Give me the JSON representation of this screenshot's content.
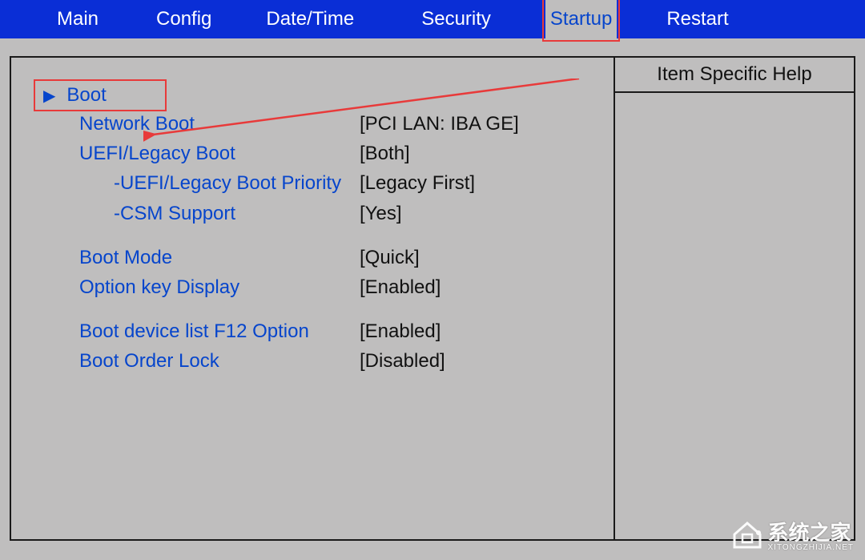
{
  "tabs": {
    "main": "Main",
    "config": "Config",
    "datetime": "Date/Time",
    "security": "Security",
    "startup": "Startup",
    "restart": "Restart"
  },
  "help": {
    "title": "Item Specific Help"
  },
  "items": {
    "boot": "Boot",
    "network_boot": {
      "label": "Network Boot",
      "value": "[PCI LAN: IBA GE]"
    },
    "uefi_legacy": {
      "label": "UEFI/Legacy Boot",
      "value": "[Both]"
    },
    "uefi_priority": {
      "label": "-UEFI/Legacy Boot Priority",
      "value": "[Legacy First]"
    },
    "csm": {
      "label": "-CSM Support",
      "value": "[Yes]"
    },
    "boot_mode": {
      "label": "Boot Mode",
      "value": "[Quick]"
    },
    "option_key": {
      "label": "Option key Display",
      "value": "[Enabled]"
    },
    "f12_option": {
      "label": "Boot device list F12 Option",
      "value": "[Enabled]"
    },
    "boot_order_lock": {
      "label": "Boot Order Lock",
      "value": "[Disabled]"
    }
  },
  "watermark": {
    "text": "系统之家",
    "sub": "XITONGZHIJIA.NET"
  }
}
